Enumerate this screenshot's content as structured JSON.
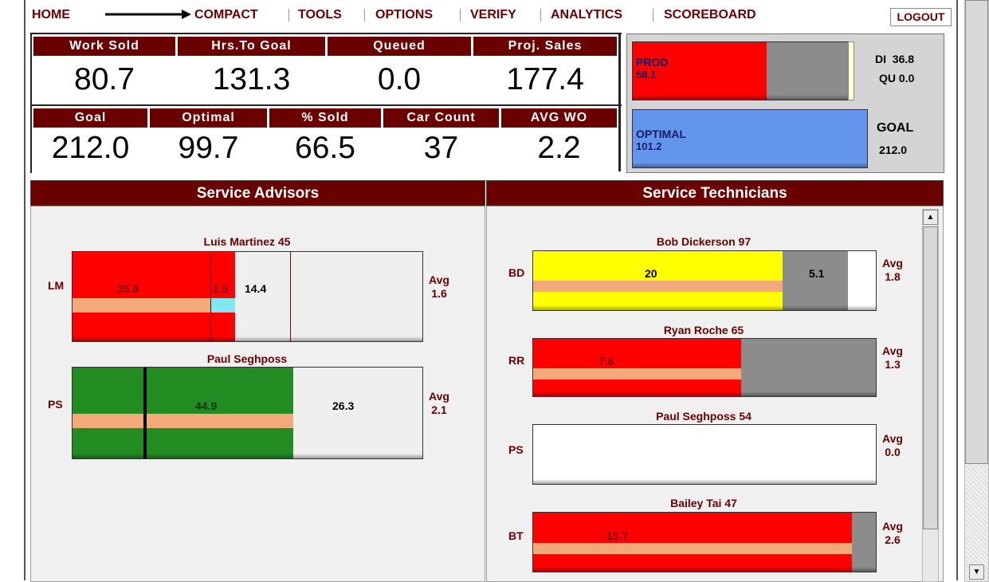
{
  "nav": {
    "home": "HOME",
    "compact": "COMPACT",
    "tools": "TOOLS",
    "options": "OPTIONS",
    "verify": "VERIFY",
    "analytics": "ANALYTICS",
    "scoreboard": "SCOREBOARD",
    "logout": "LOGOUT"
  },
  "stats_row1": [
    {
      "label": "Work Sold",
      "value": "80.7"
    },
    {
      "label": "Hrs.To Goal",
      "value": "131.3"
    },
    {
      "label": "Queued",
      "value": "0.0"
    },
    {
      "label": "Proj. Sales",
      "value": "177.4"
    }
  ],
  "stats_row2": [
    {
      "label": "Goal",
      "value": "212.0"
    },
    {
      "label": "Optimal",
      "value": "99.7"
    },
    {
      "label": "% Sold",
      "value": "66.5"
    },
    {
      "label": "Car Count",
      "value": "37"
    },
    {
      "label": "AVG WO",
      "value": "2.2"
    }
  ],
  "summary": {
    "prod_label": "PROD",
    "prod_value": "58.1",
    "di": "DI  36.8",
    "qu": "QU 0.0",
    "optimal_label": "OPTIMAL",
    "optimal_value": "101.2",
    "goal_label": "GOAL",
    "goal_value": "212.0",
    "prod_color": "#ff0000",
    "optimal_color": "#6495ed"
  },
  "advisors": {
    "title": "Service Advisors",
    "items": [
      {
        "name": "Luis Martinez 45",
        "initials": "LM",
        "main": "35.8",
        "small": "1.5",
        "remaining": "14.4",
        "avg_label": "Avg",
        "avg": "1.6"
      },
      {
        "name": "Paul Seghposs",
        "initials": "PS",
        "main": "44.9",
        "remaining": "26.3",
        "avg_label": "Avg",
        "avg": "2.1"
      }
    ]
  },
  "technicians": {
    "title": "Service Technicians",
    "items": [
      {
        "name": "Bob Dickerson 97",
        "initials": "BD",
        "main": "20",
        "second": "5.1",
        "avg_label": "Avg",
        "avg": "1.8"
      },
      {
        "name": "Ryan Roche 65",
        "initials": "RR",
        "main": "7.6",
        "avg_label": "Avg",
        "avg": "1.3"
      },
      {
        "name": "Paul Seghposs 54",
        "initials": "PS",
        "avg_label": "Avg",
        "avg": "0.0"
      },
      {
        "name": "Bailey Tai 47",
        "initials": "BT",
        "main": "15.7",
        "avg_label": "Avg",
        "avg": "2.6"
      }
    ]
  },
  "colors": {
    "accent": "#6b0000",
    "red": "#ff0000",
    "green": "#228b22",
    "yellow": "#ffff00",
    "grey": "#8c8c8c",
    "stripe": "#f4a97d",
    "cyan": "#7fe8f0",
    "blue": "#6495ed"
  }
}
